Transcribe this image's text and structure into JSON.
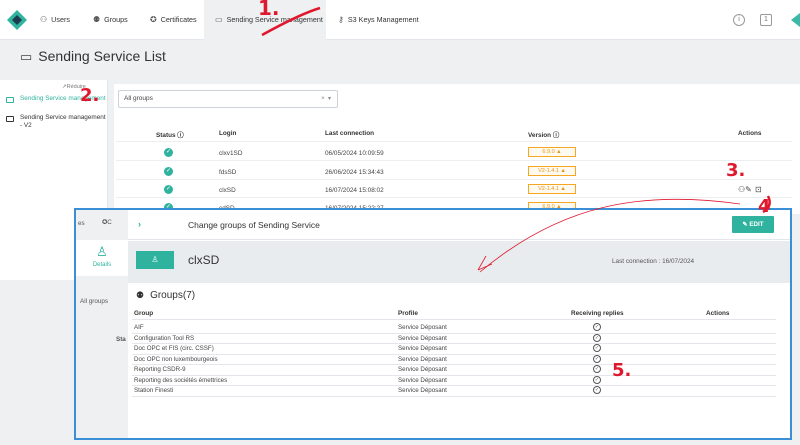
{
  "nav": {
    "tabs": [
      {
        "label": "Users",
        "icon": "users-icon"
      },
      {
        "label": "Groups",
        "icon": "groups-icon"
      },
      {
        "label": "Certificates",
        "icon": "certificate-icon"
      },
      {
        "label": "Sending Service management",
        "icon": "monitor-icon"
      },
      {
        "label": "S3 Keys Management",
        "icon": "key-icon"
      }
    ],
    "info_icon": "i",
    "sq_icon": "1"
  },
  "page": {
    "title": "Sending Service List"
  },
  "sidebar": {
    "reduce_label": "↗Réduire",
    "items": [
      {
        "label": "Sending Service management"
      },
      {
        "label": "Sending Service management - V2"
      }
    ]
  },
  "filter": {
    "value": "All groups",
    "clear": "×",
    "arrow": "▾"
  },
  "table": {
    "headers": {
      "status": "Status ⓘ",
      "login": "Login",
      "last": "Last connection",
      "version": "Version ⓘ",
      "actions": "Actions"
    },
    "rows": [
      {
        "login": "clxv1SD",
        "last": "06/05/2024 10:09:59",
        "version": "6.9.0"
      },
      {
        "login": "fdsSD",
        "last": "26/06/2024 15:34:43",
        "version": "V2-1.4.1"
      },
      {
        "login": "clxSD",
        "last": "16/07/2024 15:08:02",
        "version": "V2-1.4.1"
      },
      {
        "login": "cdSD",
        "last": "16/07/2024 15:22:27",
        "version": "6.9.0"
      }
    ]
  },
  "modal": {
    "title": "Change groups of Sending Service",
    "edit_label": "EDIT",
    "details_label": "Details",
    "left_tab_label": "es",
    "left_filter_label": "All groups",
    "left_status_label": "Sta",
    "name": "clxSD",
    "last_connection": "Last connection : 16/07/2024",
    "groups_title": "Groups(7)",
    "headers": {
      "group": "Group",
      "profile": "Profile",
      "receiving": "Receiving replies",
      "actions": "Actions"
    },
    "groups": [
      {
        "group": "AIF",
        "profile": "Service Déposant"
      },
      {
        "group": "Configuration Tool RS",
        "profile": "Service Déposant"
      },
      {
        "group": "Doc OPC et FIS (circ. CSSF)",
        "profile": "Service Déposant"
      },
      {
        "group": "Doc OPC non luxembourgeois",
        "profile": "Service Déposant"
      },
      {
        "group": "Reporting CSDR-9",
        "profile": "Service Déposant"
      },
      {
        "group": "Reporting des sociétés émettrices",
        "profile": "Service Déposant"
      },
      {
        "group": "Station Finesti",
        "profile": "Service Déposant"
      }
    ]
  },
  "annotations": [
    "1.",
    "2.",
    "3.",
    "4",
    "5."
  ],
  "colors": {
    "accent": "#2fb39f",
    "annotation": "#e0182d",
    "modal_border": "#3a8fd6",
    "warning": "#f5a623"
  }
}
